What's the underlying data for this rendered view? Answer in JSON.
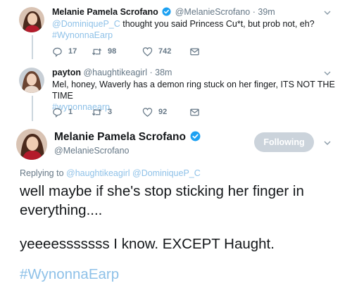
{
  "tweets": [
    {
      "name": "Melanie Pamela Scrofano",
      "handle": "@MelanieScrofano",
      "dot": "·",
      "time": "39m",
      "mention": "@DominiqueP_C",
      "text": " thought you said Princess Cu*t, but prob not, eh?",
      "hashtag": "#WynonnaEarp",
      "replies": "17",
      "retweets": "98",
      "likes": "742"
    },
    {
      "name": "payton",
      "handle": "@haughtikeagirl",
      "dot": "·",
      "time": "38m",
      "text": "Mel, honey, Waverly has a demon ring stuck on her finger, ITS NOT THE TIME",
      "hashtag": "#wynonnaearp",
      "replies": "1",
      "retweets": "3",
      "likes": "92"
    }
  ],
  "main_tweet": {
    "name": "Melanie Pamela Scrofano",
    "handle": "@MelanieScrofano",
    "follow_label": "Following",
    "replying_prefix": "Replying to ",
    "replying_mentions": "@haughtikeagirl @DominiqueP_C",
    "line1": "well maybe if she's stop sticking her finger in",
    "line2": "everything....",
    "line3": "yeeeesssssss I know. EXCEPT Haught.",
    "hashtag": "#WynonnaEarp"
  },
  "colors": {
    "link": "#1da1f2",
    "verified": "#1da1f2",
    "muted": "#657786",
    "following_button": "#cbd3db"
  },
  "icons": [
    "verified-icon",
    "reply-icon",
    "retweet-icon",
    "like-icon",
    "message-icon",
    "chevron-down-icon"
  ]
}
